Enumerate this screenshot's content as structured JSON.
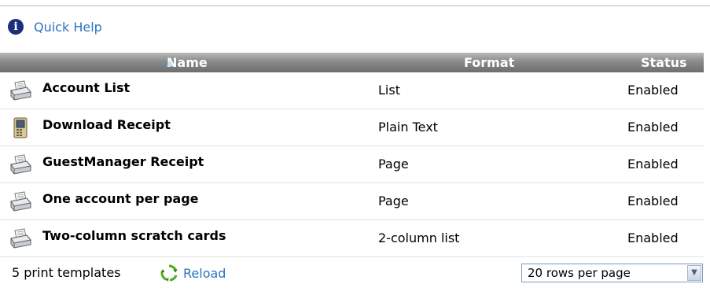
{
  "help": {
    "icon": "info-icon",
    "link_label": "Quick Help"
  },
  "table": {
    "columns": {
      "name": "Name",
      "sort_indicator": "▲",
      "format": "Format",
      "status": "Status"
    },
    "rows": [
      {
        "icon": "printer-icon",
        "name": "Account List",
        "format": "List",
        "status": "Enabled"
      },
      {
        "icon": "mobile-phone-icon",
        "name": "Download Receipt",
        "format": "Plain Text",
        "status": "Enabled"
      },
      {
        "icon": "printer-icon",
        "name": "GuestManager Receipt",
        "format": "Page",
        "status": "Enabled"
      },
      {
        "icon": "printer-icon",
        "name": "One account per page",
        "format": "Page",
        "status": "Enabled"
      },
      {
        "icon": "printer-icon",
        "name": "Two-column scratch cards",
        "format": "2-column list",
        "status": "Enabled"
      }
    ]
  },
  "footer": {
    "count_text": "5 print templates",
    "reload_label": "Reload",
    "reload_icon": "refresh-icon",
    "rows_per_page": "20 rows per page"
  },
  "colors": {
    "link": "#2a74bf",
    "header_bg": "#8a8a8a",
    "info_icon": "#1c2e7c",
    "reload_icon": "#4caf1f"
  }
}
